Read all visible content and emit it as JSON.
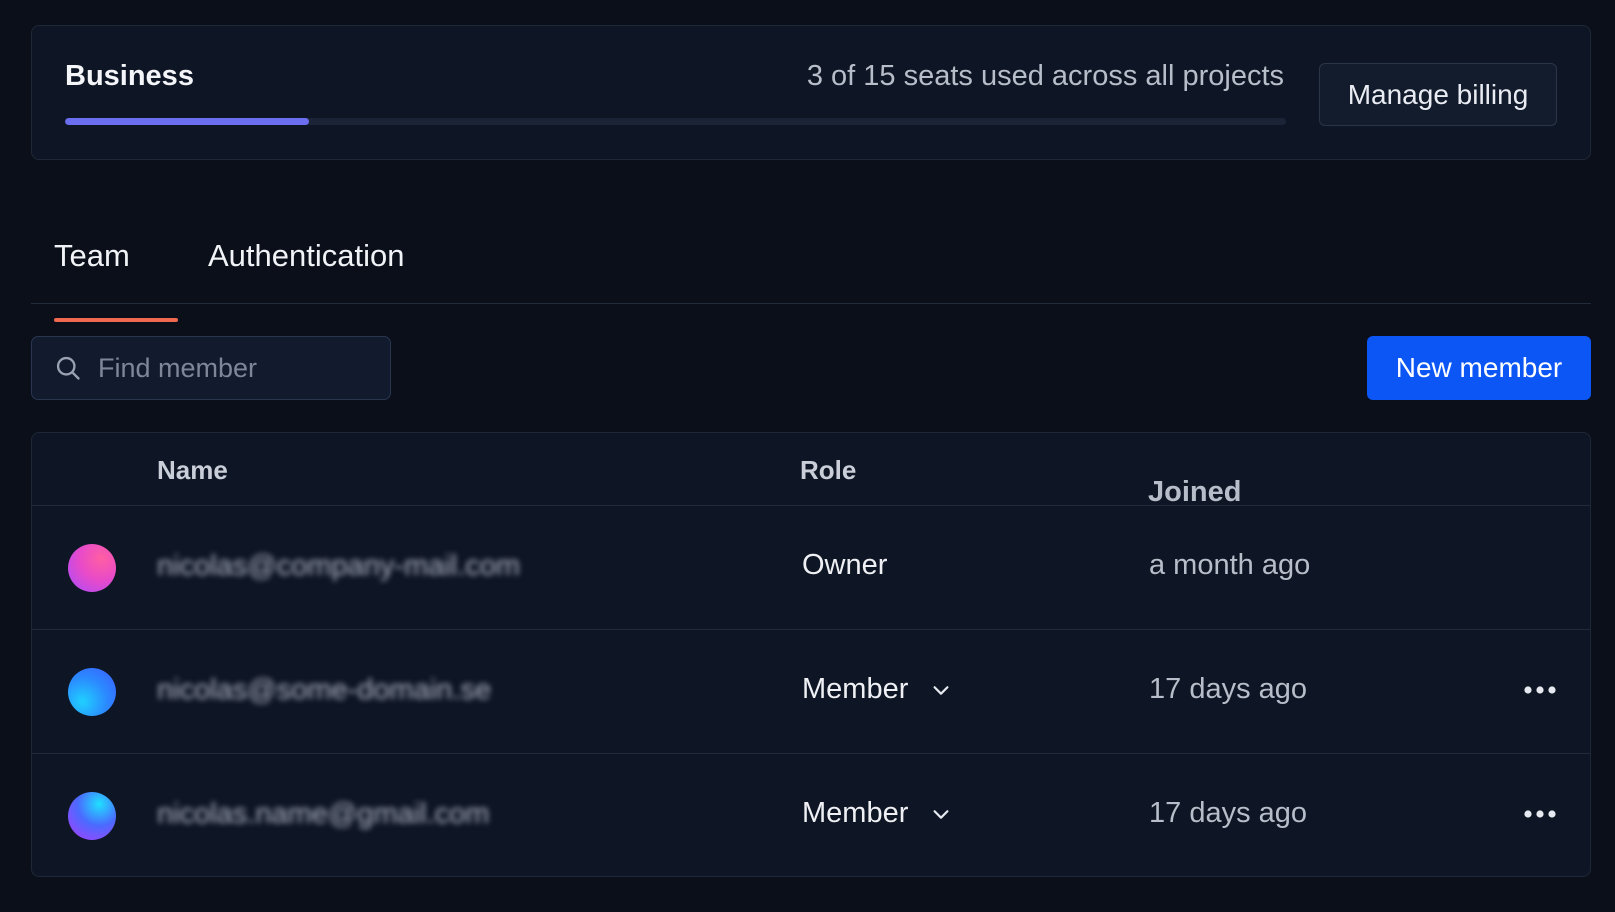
{
  "plan": {
    "name": "Business",
    "seats_text": "3 of 15 seats used across all projects",
    "seats_used": 3,
    "seats_total": 15,
    "manage_billing_label": "Manage billing",
    "progress_color": "#6b6ef0"
  },
  "tabs": [
    {
      "label": "Team",
      "active": true
    },
    {
      "label": "Authentication",
      "active": false
    }
  ],
  "toolbar": {
    "search_placeholder": "Find member",
    "new_member_label": "New member",
    "accent": "#0c56f5"
  },
  "table": {
    "columns": [
      "Name",
      "Role",
      "Joined"
    ],
    "rows": [
      {
        "avatar": "pink-gradient-avatar",
        "email": "nicolas@company-mail.com",
        "role": "Owner",
        "joined": "a month ago"
      },
      {
        "avatar": "blue-gradient-avatar",
        "email": "nicolas@some-domain.se",
        "role": "Member",
        "joined": "17 days ago"
      },
      {
        "avatar": "purple-gradient-avatar",
        "email": "nicolas.name@gmail.com",
        "role": "Member",
        "joined": "17 days ago"
      }
    ]
  }
}
